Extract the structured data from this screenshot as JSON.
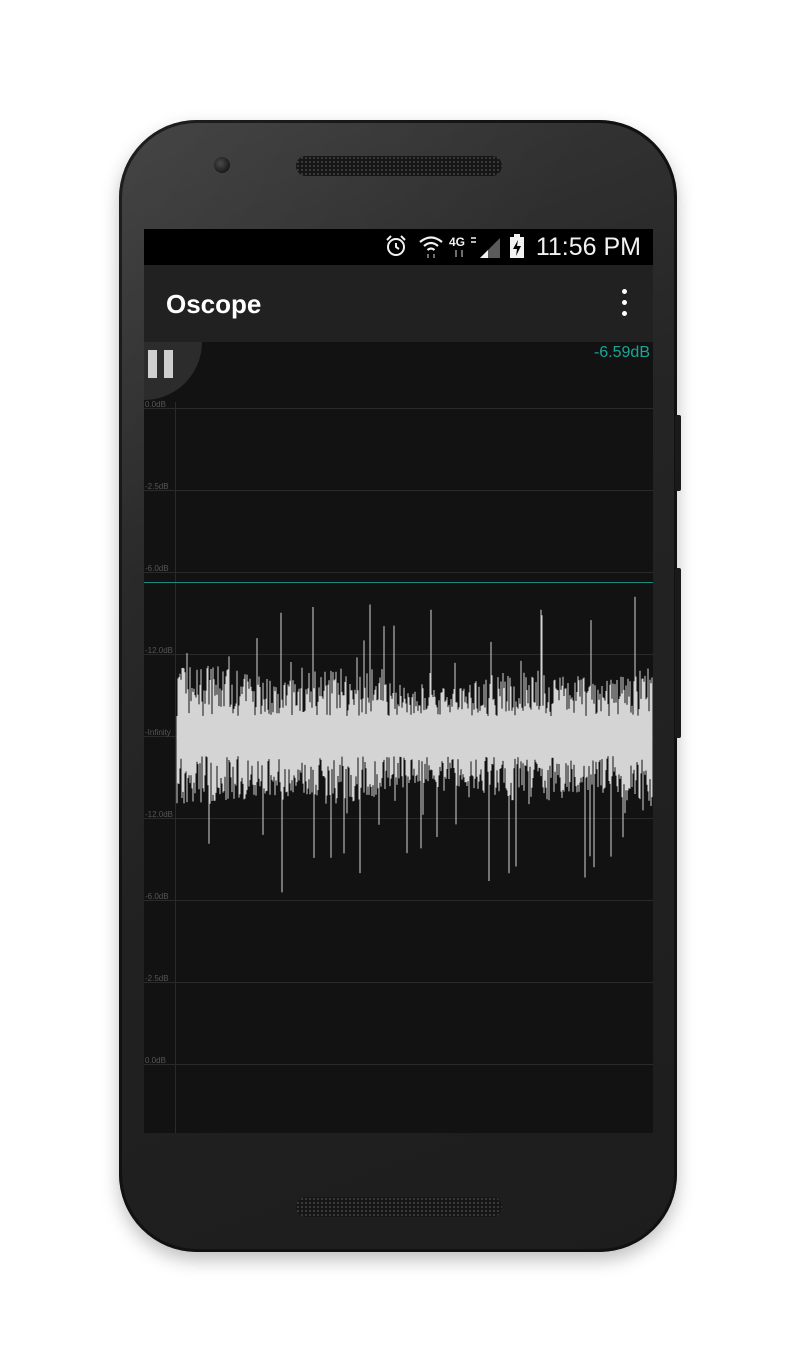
{
  "status_bar": {
    "time": "11:56 PM",
    "icons": [
      "alarm-icon",
      "wifi-icon",
      "network-4g-icon",
      "cell-signal-icon",
      "battery-charging-icon"
    ]
  },
  "app_bar": {
    "title": "Oscope",
    "menu_icon": "overflow-menu-icon"
  },
  "scope": {
    "level_readout": "-6.59dB",
    "grid_labels": [
      "0.0dB",
      "-2.5dB",
      "-6.0dB",
      "-12.0dB",
      "-Infinity",
      "-12.0dB",
      "-6.0dB",
      "-2.5dB",
      "0.0dB"
    ],
    "pause_icon": "pause-icon",
    "colors": {
      "waveform": "#d4d4d4",
      "threshold": "#1a8c80",
      "readout": "#1aa594",
      "background": "#121212"
    }
  }
}
